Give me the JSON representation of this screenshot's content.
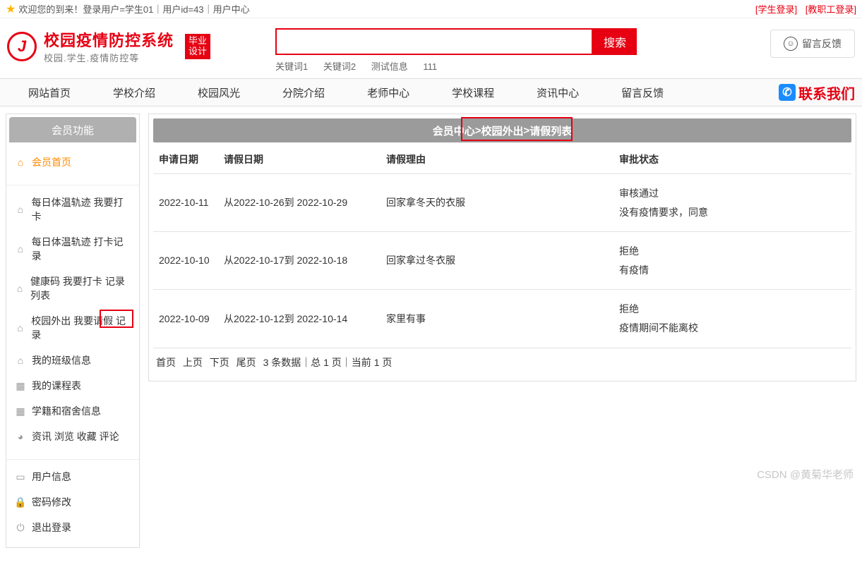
{
  "top": {
    "welcome": "欢迎您的到来！登录用户=学生01｜用户id=43｜用户中心",
    "student_login": "[学生登录]",
    "staff_login": "[教职工登录]"
  },
  "logo": {
    "title": "校园疫情防控系统",
    "subtitle": "校园.学生.疫情防控等",
    "badge_line1": "毕业",
    "badge_line2": "设计"
  },
  "search": {
    "button": "搜索",
    "keywords": [
      "关键词1",
      "关键词2",
      "测试信息",
      "111"
    ]
  },
  "feedback": {
    "label": "留言反馈"
  },
  "nav": {
    "items": [
      "网站首页",
      "学校介绍",
      "校园风光",
      "分院介绍",
      "老师中心",
      "学校课程",
      "资讯中心",
      "留言反馈"
    ],
    "contact": "联系我们"
  },
  "sidebar": {
    "title": "会员功能",
    "home": "会员首页",
    "group1": [
      "每日体温轨迹 我要打卡",
      "每日体温轨迹 打卡记录",
      "健康码 我要打卡 记录列表",
      "校园外出 我要请假 记录",
      "我的班级信息",
      "我的课程表",
      "学籍和宿舍信息",
      "资讯 浏览 收藏 评论"
    ],
    "group2": [
      "用户信息",
      "密码修改",
      "退出登录"
    ]
  },
  "breadcrumb": {
    "a": "会员中心",
    "b": "校园外出",
    "c": "请假列表",
    "sep": " > "
  },
  "table": {
    "headers": [
      "申请日期",
      "请假日期",
      "请假理由",
      "审批状态"
    ],
    "rows": [
      {
        "apply": "2022-10-11",
        "range": "从2022-10-26到 2022-10-29",
        "reason": "回家拿冬天的衣服",
        "status1": "审核通过",
        "status2": "没有疫情要求，同意"
      },
      {
        "apply": "2022-10-10",
        "range": "从2022-10-17到 2022-10-18",
        "reason": "回家拿过冬衣服",
        "status1": "拒绝",
        "status2": "有疫情"
      },
      {
        "apply": "2022-10-09",
        "range": "从2022-10-12到 2022-10-14",
        "reason": "家里有事",
        "status1": "拒绝",
        "status2": "疫情期间不能离校"
      }
    ]
  },
  "pager": {
    "first": "首页",
    "prev": "上页",
    "next": "下页",
    "last": "尾页",
    "summary": "3 条数据｜总 1 页｜当前 1 页"
  },
  "watermark": "CSDN @黄菊华老师"
}
